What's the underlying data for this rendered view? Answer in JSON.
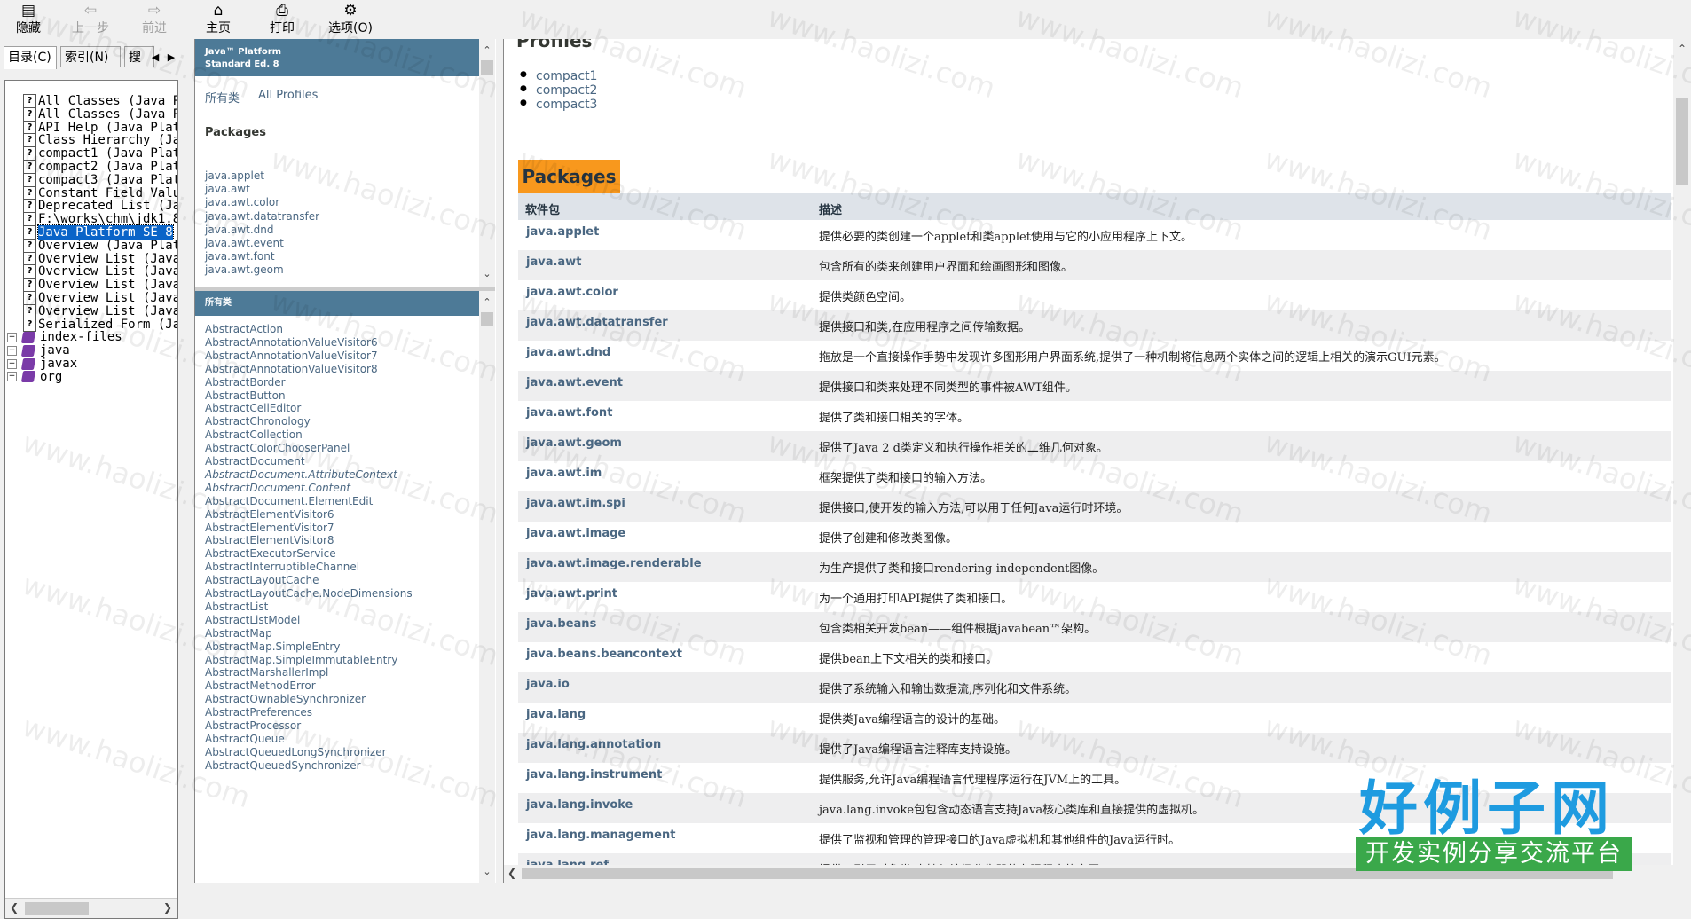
{
  "toolbar": {
    "hide": "隐藏",
    "back": "上一步",
    "forward": "前进",
    "home": "主页",
    "print": "打印",
    "options": "选项(O)"
  },
  "nav": {
    "tabs": [
      "目录(C)",
      "索引(N)",
      "搜"
    ],
    "tree": [
      {
        "label": "All Classes (Java P",
        "type": "page"
      },
      {
        "label": "All Classes (Java P",
        "type": "page"
      },
      {
        "label": "API Help (Java Plat",
        "type": "page"
      },
      {
        "label": "Class Hierarchy (Ja",
        "type": "page"
      },
      {
        "label": "compact1 (Java Plat",
        "type": "page"
      },
      {
        "label": "compact2 (Java Plat",
        "type": "page"
      },
      {
        "label": "compact3 (Java Plat",
        "type": "page"
      },
      {
        "label": "Constant Field Valu",
        "type": "page"
      },
      {
        "label": "Deprecated List (Ja",
        "type": "page"
      },
      {
        "label": "F:\\works\\chm\\jdk1.8",
        "type": "page"
      },
      {
        "label": "Java Platform SE 8",
        "type": "page",
        "selected": true
      },
      {
        "label": "Overview (Java Plat",
        "type": "page"
      },
      {
        "label": "Overview List (Java",
        "type": "page"
      },
      {
        "label": "Overview List (Java",
        "type": "page"
      },
      {
        "label": "Overview List (Java",
        "type": "page"
      },
      {
        "label": "Overview List (Java",
        "type": "page"
      },
      {
        "label": "Overview List (Java",
        "type": "page"
      },
      {
        "label": "Serialized Form (Ja",
        "type": "page"
      },
      {
        "label": "index-files",
        "type": "book"
      },
      {
        "label": "java",
        "type": "book"
      },
      {
        "label": "javax",
        "type": "book"
      },
      {
        "label": "org",
        "type": "book"
      }
    ]
  },
  "packages_frame": {
    "header_line1": "Java™ Platform",
    "header_line2": "Standard Ed. 8",
    "link_all_classes": "所有类",
    "link_all_profiles": "All Profiles",
    "packages_title": "Packages",
    "packages": [
      "java.applet",
      "java.awt",
      "java.awt.color",
      "java.awt.datatransfer",
      "java.awt.dnd",
      "java.awt.event",
      "java.awt.font",
      "java.awt.geom"
    ]
  },
  "classes_frame": {
    "header": "所有类",
    "classes": [
      {
        "name": "AbstractAction"
      },
      {
        "name": "AbstractAnnotationValueVisitor6"
      },
      {
        "name": "AbstractAnnotationValueVisitor7"
      },
      {
        "name": "AbstractAnnotationValueVisitor8"
      },
      {
        "name": "AbstractBorder"
      },
      {
        "name": "AbstractButton"
      },
      {
        "name": "AbstractCellEditor"
      },
      {
        "name": "AbstractChronology"
      },
      {
        "name": "AbstractCollection"
      },
      {
        "name": "AbstractColorChooserPanel"
      },
      {
        "name": "AbstractDocument"
      },
      {
        "name": "AbstractDocument.AttributeContext",
        "italic": true
      },
      {
        "name": "AbstractDocument.Content",
        "italic": true
      },
      {
        "name": "AbstractDocument.ElementEdit"
      },
      {
        "name": "AbstractElementVisitor6"
      },
      {
        "name": "AbstractElementVisitor7"
      },
      {
        "name": "AbstractElementVisitor8"
      },
      {
        "name": "AbstractExecutorService"
      },
      {
        "name": "AbstractInterruptibleChannel"
      },
      {
        "name": "AbstractLayoutCache"
      },
      {
        "name": "AbstractLayoutCache.NodeDimensions"
      },
      {
        "name": "AbstractList"
      },
      {
        "name": "AbstractListModel"
      },
      {
        "name": "AbstractMap"
      },
      {
        "name": "AbstractMap.SimpleEntry"
      },
      {
        "name": "AbstractMap.SimpleImmutableEntry"
      },
      {
        "name": "AbstractMarshallerImpl"
      },
      {
        "name": "AbstractMethodError"
      },
      {
        "name": "AbstractOwnableSynchronizer"
      },
      {
        "name": "AbstractPreferences"
      },
      {
        "name": "AbstractProcessor"
      },
      {
        "name": "AbstractQueue"
      },
      {
        "name": "AbstractQueuedLongSynchronizer"
      },
      {
        "name": "AbstractQueuedSynchronizer"
      }
    ]
  },
  "main": {
    "profiles_title": "Profiles",
    "profiles": [
      "compact1",
      "compact2",
      "compact3"
    ],
    "packages_caption": "Packages",
    "col_package": "软件包",
    "col_description": "描述",
    "rows": [
      {
        "name": "java.applet",
        "desc": "提供必要的类创建一个applet和类applet使用与它的小应用程序上下文。"
      },
      {
        "name": "java.awt",
        "desc": "包含所有的类来创建用户界面和绘画图形和图像。"
      },
      {
        "name": "java.awt.color",
        "desc": "提供类颜色空间。"
      },
      {
        "name": "java.awt.datatransfer",
        "desc": "提供接口和类,在应用程序之间传输数据。"
      },
      {
        "name": "java.awt.dnd",
        "desc": "拖放是一个直接操作手势中发现许多图形用户界面系统,提供了一种机制将信息两个实体之间的逻辑上相关的演示GUI元素。"
      },
      {
        "name": "java.awt.event",
        "desc": "提供接口和类来处理不同类型的事件被AWT组件。"
      },
      {
        "name": "java.awt.font",
        "desc": "提供了类和接口相关的字体。"
      },
      {
        "name": "java.awt.geom",
        "desc": "提供了Java 2 d类定义和执行操作相关的二维几何对象。"
      },
      {
        "name": "java.awt.im",
        "desc": "框架提供了类和接口的输入方法。"
      },
      {
        "name": "java.awt.im.spi",
        "desc": "提供接口,使开发的输入方法,可以用于任何Java运行时环境。"
      },
      {
        "name": "java.awt.image",
        "desc": "提供了创建和修改类图像。"
      },
      {
        "name": "java.awt.image.renderable",
        "desc": "为生产提供了类和接口rendering-independent图像。"
      },
      {
        "name": "java.awt.print",
        "desc": "为一个通用打印API提供了类和接口。"
      },
      {
        "name": "java.beans",
        "desc": "包含类相关开发bean——组件根据javabean™架构。"
      },
      {
        "name": "java.beans.beancontext",
        "desc": "提供bean上下文相关的类和接口。"
      },
      {
        "name": "java.io",
        "desc": "提供了系统输入和输出数据流,序列化和文件系统。"
      },
      {
        "name": "java.lang",
        "desc": "提供类Java编程语言的设计的基础。"
      },
      {
        "name": "java.lang.annotation",
        "desc": "提供了Java编程语言注释库支持设施。"
      },
      {
        "name": "java.lang.instrument",
        "desc": "提供服务,允许Java编程语言代理程序运行在JVM上的工具。"
      },
      {
        "name": "java.lang.invoke",
        "desc": "java.lang.invoke包包含动态语言支持Java核心类库和直接提供的虚拟机。"
      },
      {
        "name": "java.lang.management",
        "desc": "提供了监视和管理的管理接口的Java虚拟机和其他组件的Java运行时。"
      },
      {
        "name": "java.lang.ref",
        "desc": "提供了引用对象类,支持与垃圾收集器的有限程度的交互。"
      }
    ]
  },
  "watermark": {
    "text": "www.haolizi.com",
    "logo_big": "好例子网",
    "logo_small": "开发实例分享交流平台"
  }
}
